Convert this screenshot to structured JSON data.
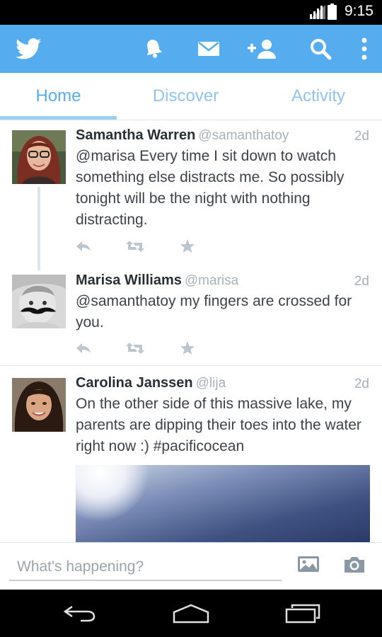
{
  "status_bar": {
    "time": "9:15"
  },
  "action_bar": {
    "icons": [
      "twitter-bird-icon",
      "notifications-bell-icon",
      "messages-envelope-icon",
      "add-user-icon",
      "search-icon",
      "overflow-menu-icon"
    ],
    "color": "#55acee"
  },
  "tabs": [
    {
      "label": "Home",
      "active": true
    },
    {
      "label": "Discover",
      "active": false
    },
    {
      "label": "Activity",
      "active": false
    }
  ],
  "tweets": [
    {
      "name": "Samantha Warren",
      "handle": "@samanthatoy",
      "time": "2d",
      "text": "@marisa Every time I sit down to watch something else distracts me. So possibly tonight will be the night with nothing distracting."
    },
    {
      "name": "Marisa Williams",
      "handle": "@marisa",
      "time": "2d",
      "text": "@samanthatoy my fingers are crossed for you."
    },
    {
      "name": "Carolina Janssen",
      "handle": "@lija",
      "time": "2d",
      "text": "On the other side of this massive lake, my parents are dipping their toes into the water right now :) #pacificocean"
    }
  ],
  "compose": {
    "placeholder": "What's happening?",
    "icons": [
      "photo-gallery-icon",
      "camera-icon"
    ]
  },
  "nav_bar": {
    "icons": [
      "back-icon",
      "home-icon",
      "recents-icon"
    ]
  },
  "colors": {
    "accent": "#55acee",
    "tab_inactive": "#8ec4ee",
    "muted": "#a7b1b9"
  }
}
